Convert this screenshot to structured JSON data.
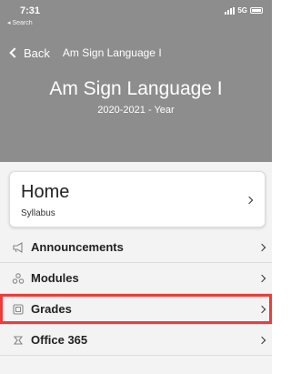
{
  "status_bar": {
    "time": "7:31",
    "back_hint": "◂ Search",
    "network": "5G"
  },
  "navbar": {
    "back_label": "Back",
    "title": "Am Sign Language I"
  },
  "course": {
    "title": "Am Sign Language I",
    "term": "2020-2021 - Year"
  },
  "home_card": {
    "title": "Home",
    "subtitle": "Syllabus"
  },
  "menu": {
    "items": [
      {
        "label": "Announcements",
        "icon": "megaphone-icon"
      },
      {
        "label": "Modules",
        "icon": "modules-icon"
      },
      {
        "label": "Grades",
        "icon": "grades-icon",
        "highlighted": true
      },
      {
        "label": "Office 365",
        "icon": "office-icon"
      }
    ]
  },
  "colors": {
    "header": "#8d8d8d",
    "highlight": "#ee3b3b"
  }
}
